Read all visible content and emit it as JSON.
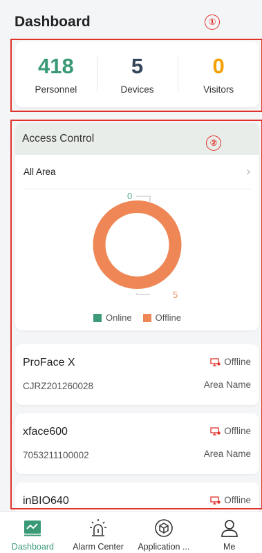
{
  "header": {
    "title": "Dashboard"
  },
  "annotations": {
    "marker_1": "①",
    "marker_2": "②"
  },
  "stats": [
    {
      "value": "418",
      "label": "Personnel",
      "color": "#3a9a76"
    },
    {
      "value": "5",
      "label": "Devices",
      "color": "#34465a"
    },
    {
      "value": "0",
      "label": "Visitors",
      "color": "#f5a000"
    }
  ],
  "access_control": {
    "title": "Access Control",
    "area_label": "All Area",
    "online_count": "0",
    "offline_count": "5",
    "legend": {
      "online": "Online",
      "offline": "Offline"
    },
    "colors": {
      "online": "#3d9b79",
      "offline": "#ee8656"
    }
  },
  "devices": [
    {
      "name": "ProFace X",
      "serial": "CJRZ201260028",
      "status": "Offline",
      "area": "Area Name"
    },
    {
      "name": "xface600",
      "serial": "7053211100002",
      "status": "Offline",
      "area": "Area Name"
    },
    {
      "name": "inBIO640",
      "status": "Offline"
    }
  ],
  "tabbar": [
    {
      "label": "Dashboard",
      "icon": "dashboard-icon",
      "active": true
    },
    {
      "label": "Alarm Center",
      "icon": "alarm-icon",
      "active": false
    },
    {
      "label": "Application ...",
      "icon": "application-icon",
      "active": false
    },
    {
      "label": "Me",
      "icon": "person-icon",
      "active": false
    }
  ]
}
